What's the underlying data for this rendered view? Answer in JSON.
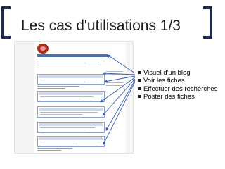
{
  "slide": {
    "title": "Les cas d'utilisations 1/3"
  },
  "bullets": [
    "Visuel d'un blog",
    "Voir les fiches",
    "Effectuer des recherches",
    "Poster des fiches"
  ],
  "colors": {
    "bracket": "#1e2b4e",
    "arrow": "#3a5db0",
    "blog_accent": "#b22a1c",
    "blog_link": "#2a4d9c"
  }
}
